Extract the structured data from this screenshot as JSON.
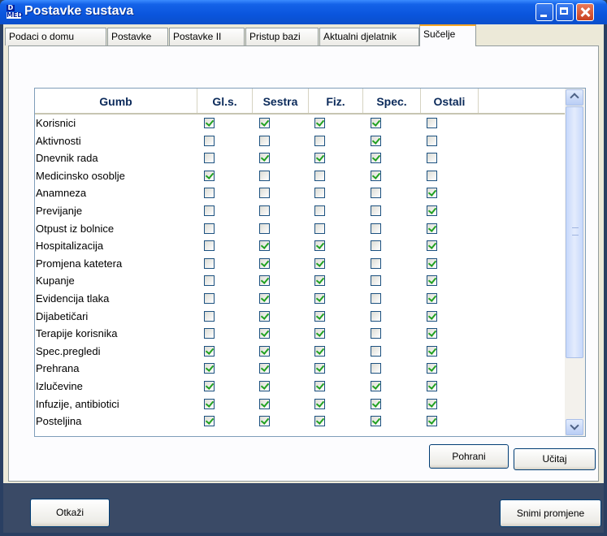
{
  "window": {
    "title": "Postavke sustava",
    "icon_top": "D",
    "icon_bottom": "MED"
  },
  "tabs": [
    {
      "label": "Podaci o domu"
    },
    {
      "label": "Postavke"
    },
    {
      "label": "Postavke II"
    },
    {
      "label": "Pristup bazi"
    },
    {
      "label": "Aktualni djelatnik"
    },
    {
      "label": "Sučelje",
      "active": true
    }
  ],
  "grid": {
    "columns": [
      "Gumb",
      "Gl.s.",
      "Sestra",
      "Fiz.",
      "Spec.",
      "Ostali"
    ],
    "rows": [
      {
        "label": "Korisnici",
        "checks": [
          1,
          1,
          1,
          1,
          0
        ]
      },
      {
        "label": "Aktivnosti",
        "checks": [
          0,
          0,
          0,
          1,
          0
        ]
      },
      {
        "label": "Dnevnik rada",
        "checks": [
          0,
          1,
          1,
          1,
          0
        ]
      },
      {
        "label": "Medicinsko osoblje",
        "checks": [
          1,
          0,
          0,
          1,
          0
        ]
      },
      {
        "label": "Anamneza",
        "checks": [
          0,
          0,
          0,
          0,
          1
        ]
      },
      {
        "label": "Previjanje",
        "checks": [
          0,
          0,
          0,
          0,
          1
        ]
      },
      {
        "label": "Otpust iz bolnice",
        "checks": [
          0,
          0,
          0,
          0,
          1
        ]
      },
      {
        "label": "Hospitalizacija",
        "checks": [
          0,
          1,
          1,
          0,
          1
        ]
      },
      {
        "label": "Promjena katetera",
        "checks": [
          0,
          1,
          1,
          0,
          1
        ]
      },
      {
        "label": "Kupanje",
        "checks": [
          0,
          1,
          1,
          0,
          1
        ]
      },
      {
        "label": "Evidencija tlaka",
        "checks": [
          0,
          1,
          1,
          0,
          1
        ]
      },
      {
        "label": "Dijabetičari",
        "checks": [
          0,
          1,
          1,
          0,
          1
        ]
      },
      {
        "label": "Terapije korisnika",
        "checks": [
          0,
          1,
          1,
          0,
          1
        ]
      },
      {
        "label": "Spec.pregledi",
        "checks": [
          1,
          1,
          1,
          0,
          1
        ]
      },
      {
        "label": "Prehrana",
        "checks": [
          1,
          1,
          1,
          0,
          1
        ]
      },
      {
        "label": "Izlučevine",
        "checks": [
          1,
          1,
          1,
          1,
          1
        ]
      },
      {
        "label": "Infuzije, antibiotici",
        "checks": [
          1,
          1,
          1,
          1,
          1
        ]
      },
      {
        "label": "Posteljina",
        "checks": [
          1,
          1,
          1,
          1,
          1
        ]
      }
    ]
  },
  "buttons": {
    "save": "Pohrani",
    "load": "Učitaj",
    "cancel": "Otkaži",
    "apply": "Snimi promjene"
  }
}
